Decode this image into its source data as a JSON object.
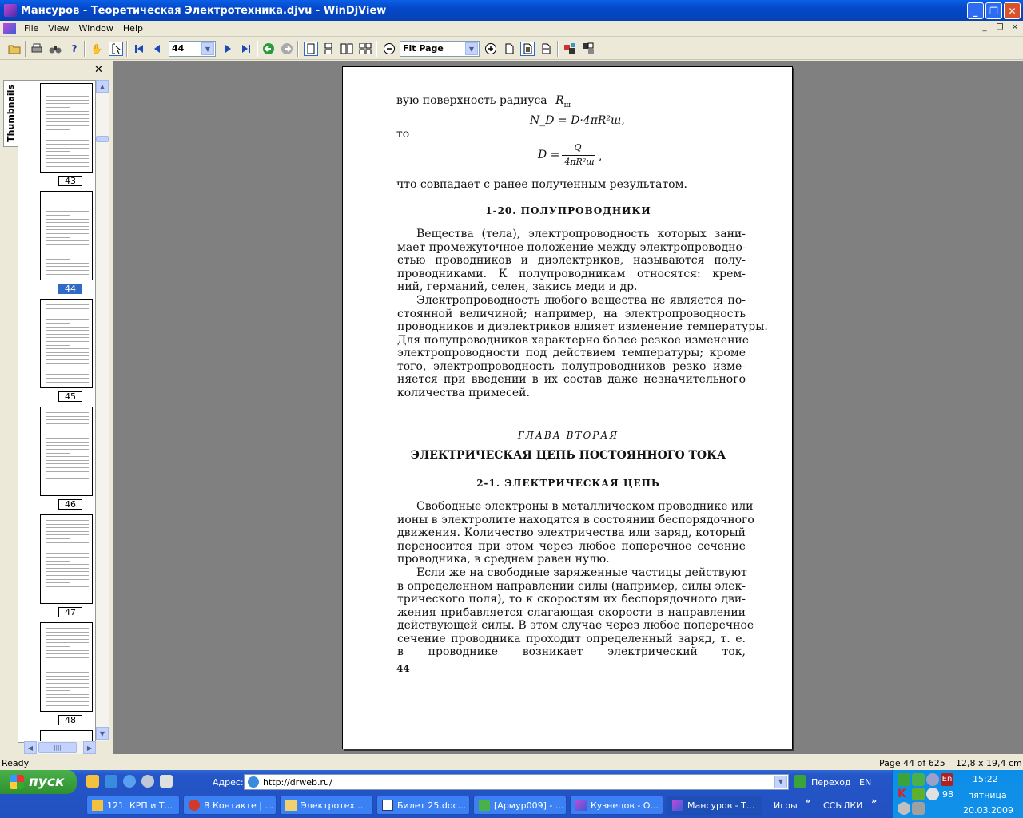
{
  "window": {
    "title": "Мансуров - Теоретическая Электротехника.djvu - WinDjView",
    "min_label": "_",
    "max_label": "❐",
    "close_label": "✕"
  },
  "menu": [
    "File",
    "View",
    "Window",
    "Help"
  ],
  "toolbar": {
    "page_value": "44",
    "zoom_value": "Fit Page"
  },
  "sidebar": {
    "tab_label": "Thumbnails",
    "close_label": "✕",
    "thumbnails": [
      {
        "page": "43",
        "selected": false
      },
      {
        "page": "44",
        "selected": true
      },
      {
        "page": "45",
        "selected": false
      },
      {
        "page": "46",
        "selected": false
      },
      {
        "page": "47",
        "selected": false
      },
      {
        "page": "48",
        "selected": false
      }
    ]
  },
  "document": {
    "line1": "вую поверхность радиуса",
    "line1_var": "R",
    "line1_sub": "ш",
    "formula1": "N_D = D·4πR²ш,",
    "then_word": "то",
    "formula2_left": "D =",
    "formula2_num": "Q",
    "formula2_den": "4πR²ш",
    "formula2_comma": ",",
    "result_line": "что совпадает с ранее полученным результатом.",
    "section_120": "1-20. ПОЛУПРОВОДНИКИ",
    "para1": [
      "Вещества (тела), электропроводность которых зани-",
      "мает промежуточное положение между электропроводно-",
      "стью проводников и диэлектриков, называются полу-",
      "проводниками. К полупроводникам относятся: крем-",
      "ний, германий, селен, закись меди и др."
    ],
    "para2": [
      "Электропроводность любого вещества не является по-",
      "стоянной величиной; например, на электропроводность",
      "проводников и диэлектриков влияет изменение температуры.",
      "Для полупроводников характерно более резкое изменение",
      "электропроводности под действием температуры; кроме",
      "того, электропроводность полупроводников резко изме-",
      "няется при введении в их состав даже незначительного",
      "количества примесей."
    ],
    "chapter_label": "ГЛАВА ВТОРАЯ",
    "chapter_title": "ЭЛЕКТРИЧЕСКАЯ ЦЕПЬ ПОСТОЯННОГО ТОКА",
    "section_21": "2-1. ЭЛЕКТРИЧЕСКАЯ ЦЕПЬ",
    "para3": [
      "Свободные электроны в металлическом проводнике или",
      "ионы в электролите находятся в состоянии беспорядочного",
      "движения. Количество электричества или заряд, который",
      "переносится при этом через любое поперечное сечение",
      "проводника, в среднем равен нулю."
    ],
    "para4": [
      "Если же на свободные заряженные частицы действуют",
      "в определенном направлении силы (например, силы элек-",
      "трического поля), то к скоростям их беспорядочного дви-",
      "жения прибавляется слагающая скорости в направлении",
      "действующей силы. В этом случае через любое поперечное",
      "сечение проводника проходит определенный заряд, т. е.",
      "в проводнике возникает электрический ток,"
    ],
    "page_number": "44"
  },
  "status": {
    "left": "Ready",
    "page_info": "Page 44 of 625",
    "size_info": "12,8 x 19,4 cm"
  },
  "taskbar": {
    "start_label": "пуск",
    "address_label": "Адрес:",
    "address_value": "http://drweb.ru/",
    "go_label": "Переход",
    "lang": "EN",
    "tasks": [
      "121. КРП и Т...",
      "В Контакте | ...",
      "Электротех...",
      "Билет 25.doc...",
      "[Армур009] - ...",
      "Кузнецов - О...",
      "Мансуров - Т..."
    ],
    "games_label": "Игры",
    "links_label": "ССЫЛКИ",
    "tray_lang": "En",
    "tray_num": "98",
    "clock_time": "15:22",
    "clock_day": "пятница",
    "clock_date": "20.03.2009"
  }
}
